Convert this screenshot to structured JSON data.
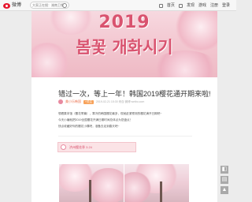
{
  "header": {
    "logo_text": "微博",
    "search_placeholder": "大家正在搜：湖南卫视春晚节目单",
    "nav": [
      "首页",
      "发现",
      "游戏",
      "注册",
      "登录"
    ]
  },
  "banner": {
    "year": "2019",
    "title": "봄꽃 개화시기"
  },
  "article": {
    "title": "错过一次，等上一年！韩国2019樱花通开期来啦!",
    "author": "美小乐韩国",
    "follow_label": "+关注",
    "time": "2019-02-21 15:30 来自 微博 weibo.com",
    "paragraphs": [
      "想看果本馆（樱花季篇），寒冷的韩国樱花最多，现就赶紧预测的樱花满开日期吧~",
      "今天小编就把2019全国樱花开满日期时间总体点为您盘点！",
      "快点收藏好你的樱花小棵吧，准备去走到春天吧~"
    ],
    "tag_label": "济州樱花季 3.24"
  },
  "colors": {
    "accent": "#d9536f",
    "brand": "#e6162d",
    "banner_bg": "#f3c9d2"
  },
  "icons": {
    "logo": "weibo-logo-icon",
    "search": "search-icon",
    "back_top": "arrow-up-icon"
  }
}
